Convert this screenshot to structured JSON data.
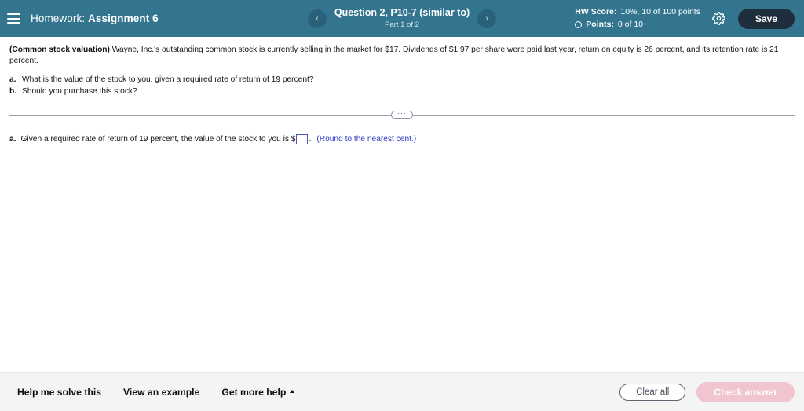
{
  "header": {
    "menu_icon": "hamburger-menu-icon",
    "title_label": "Homework:",
    "title_value": "Assignment 6",
    "prev_icon": "chevron-left-icon",
    "next_icon": "chevron-right-icon",
    "question_title": "Question 2, P10-7 (similar to)",
    "question_part": "Part 1 of 2",
    "hw_score_label": "HW Score:",
    "hw_score_value": "10%, 10 of 100 points",
    "points_label": "Points:",
    "points_value": "0 of 10",
    "points_status_icon": "empty-circle-icon",
    "settings_icon": "gear-icon",
    "save_label": "Save",
    "bg_color": "#33758f",
    "save_bg_color": "#1e2e3c"
  },
  "question": {
    "topic": "(Common stock valuation)",
    "body": "Wayne, Inc.'s outstanding common stock is currently selling in the market for $17.  Dividends of $1.97 per share were paid last year, return on equity is 26 percent, and its retention rate is 21 percent.",
    "parts": [
      {
        "key": "a.",
        "text": "What is the value of the stock to you, given a required rate of return of 19 percent?"
      },
      {
        "key": "b.",
        "text": "Should you purchase this stock?"
      }
    ]
  },
  "divider": {
    "collapse_dots": "···"
  },
  "answer": {
    "key": "a.",
    "prompt": "Given a required rate of return of 19 percent, the value of the stock to you is $",
    "input_value": "",
    "input_placeholder": "",
    "suffix": ".",
    "rounding_note": "(Round to the nearest cent.)",
    "note_color": "#2b39c6",
    "input_border_color": "#4a57c4"
  },
  "footer": {
    "links": [
      {
        "label": "Help me solve this",
        "has_caret": false
      },
      {
        "label": "View an example",
        "has_caret": false
      },
      {
        "label": "Get more help",
        "has_caret": true
      }
    ],
    "clear_label": "Clear all",
    "check_label": "Check answer",
    "check_bg_color": "#f0c5cf",
    "bg_color": "#f4f4f4"
  }
}
